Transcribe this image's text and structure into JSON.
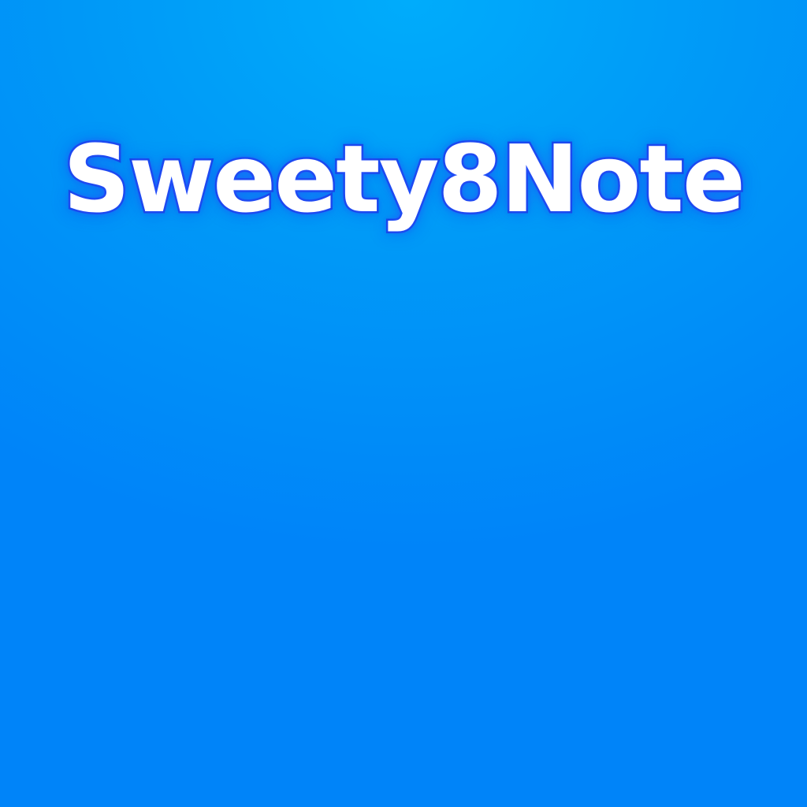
{
  "app": {
    "title": "Sweety8Note"
  },
  "colors": {
    "background_top": "#00acfb",
    "background_bottom": "#0084f9",
    "title_fill": "#ffffff",
    "title_outline": "#1646e6"
  }
}
